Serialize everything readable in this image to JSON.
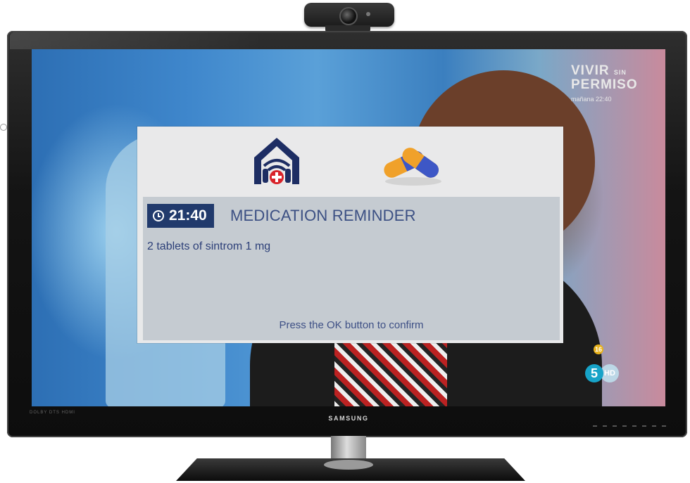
{
  "tv": {
    "brand": "SAMSUNG",
    "bottom_left_logos": "DOLBY DTS HDMI"
  },
  "broadcast": {
    "show_title_line1": "VIVIR",
    "show_title_small": "SIN",
    "show_title_line2": "PERMISO",
    "show_schedule": "mañana 22:40",
    "age_rating": "16",
    "channel_number": "5",
    "channel_hd": "HD"
  },
  "reminder": {
    "time": "21:40",
    "title": "MEDICATION REMINDER",
    "description": "2 tablets of sintrom 1 mg",
    "confirm_hint": "Press the OK button to confirm",
    "icons": [
      "home-care-logo-icon",
      "pill-capsules-icon",
      "clock-icon"
    ],
    "colors": {
      "badge_bg": "#213a6c",
      "text": "#3b4f83",
      "body_bg": "#c5cbd1",
      "header_bg": "#e9e9ea"
    }
  }
}
